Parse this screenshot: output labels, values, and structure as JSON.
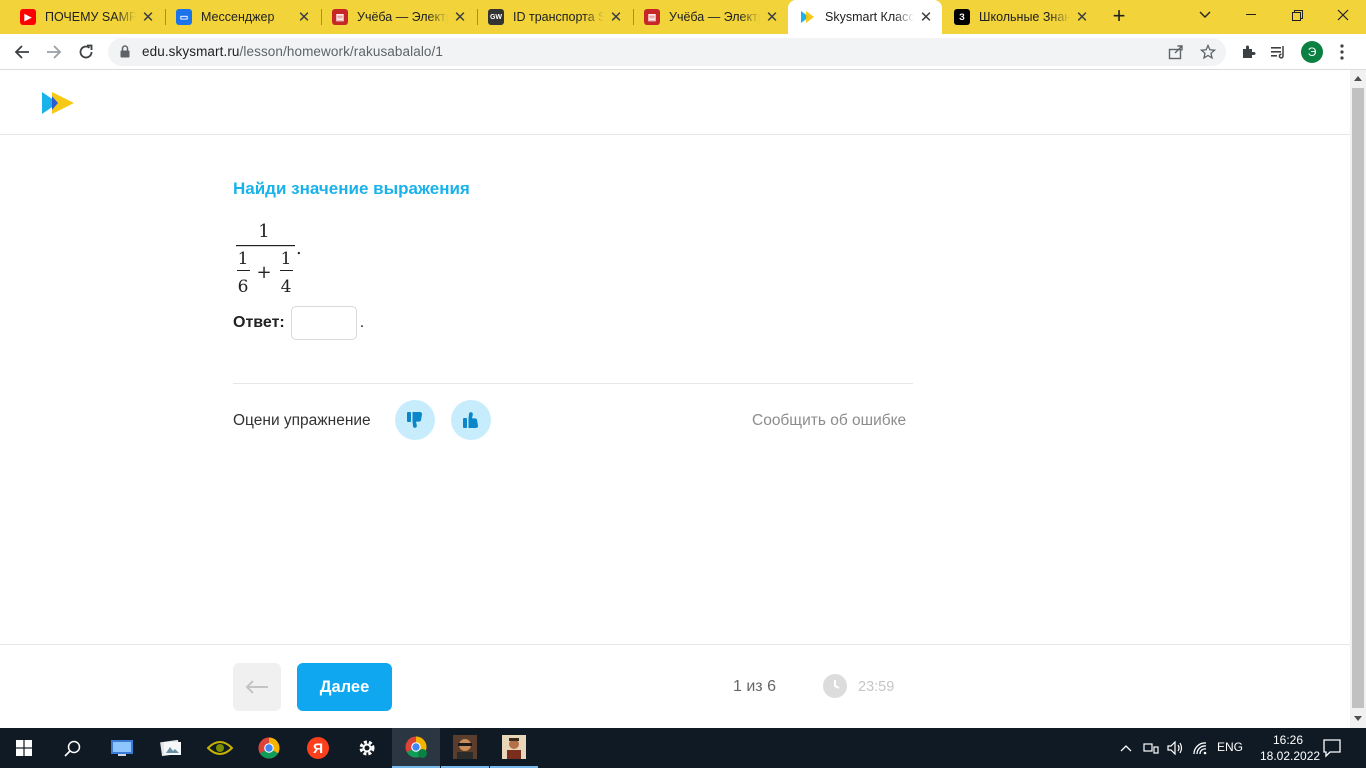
{
  "browser": {
    "tabs": [
      {
        "title": "ПОЧЕМУ SAMP У",
        "icon": "youtube-icon",
        "color": "#ff0000"
      },
      {
        "title": "Мессенджер",
        "icon": "messenger-icon",
        "color": "#1a73e8"
      },
      {
        "title": "Учёба — Электр",
        "icon": "book-icon",
        "color": "#c62828"
      },
      {
        "title": "ID транспорта SA",
        "icon": "site-icon",
        "color": "#333333"
      },
      {
        "title": "Учёба — Электр",
        "icon": "book-icon",
        "color": "#c62828"
      },
      {
        "title": "Skysmart Класс",
        "icon": "skysmart-icon",
        "color": "#1ab2ea",
        "active": true
      },
      {
        "title": "Школьные Знан",
        "icon": "znania-icon",
        "color": "#000000"
      }
    ],
    "url_host": "edu.skysmart.ru",
    "url_path": "/lesson/homework/rakusabalalo/1",
    "profile_letter": "Э"
  },
  "task": {
    "title": "Найди значение выражения",
    "formula": {
      "numerator": "1",
      "term1_num": "1",
      "term1_den": "6",
      "operator": "+",
      "term2_num": "1",
      "term2_den": "4",
      "end_mark": "."
    },
    "answer_label": "Ответ:",
    "answer_value": "",
    "answer_end": "."
  },
  "rating": {
    "label": "Оцени упражнение",
    "report_link": "Сообщить об ошибке"
  },
  "footer": {
    "next_label": "Далее",
    "progress": "1 из 6",
    "timer": "23:59"
  },
  "taskbar": {
    "language": "ENG",
    "time": "16:26",
    "date": "18.02.2022"
  },
  "colors": {
    "tabstrip": "#f2d43a",
    "accent": "#1ab2ea",
    "next_button": "#0ea7f0",
    "rate_button_bg": "#c7ecfb"
  }
}
